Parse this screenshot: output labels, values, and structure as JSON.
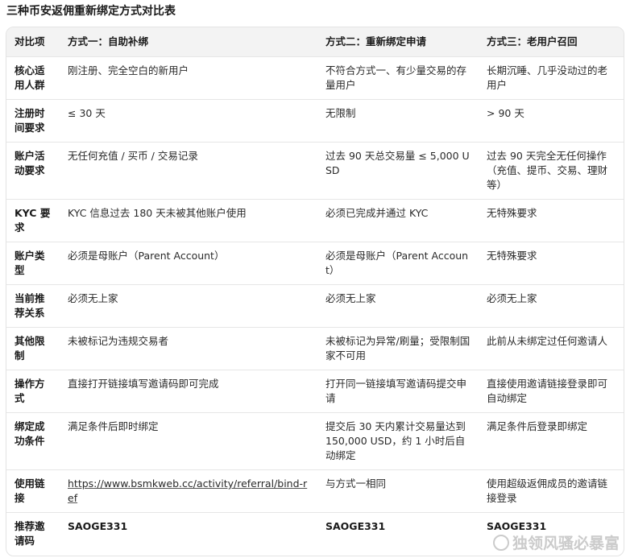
{
  "title": "三种币安返佣重新绑定方式对比表",
  "table": {
    "headers": [
      "对比项",
      "方式一：自助补绑",
      "方式二：重新绑定申请",
      "方式三：老用户召回"
    ],
    "rows": [
      [
        "核心适用人群",
        "刚注册、完全空白的新用户",
        "不符合方式一、有少量交易的存量用户",
        "长期沉睡、几乎没动过的老用户"
      ],
      [
        "注册时间要求",
        "≤ 30 天",
        "无限制",
        "> 90 天"
      ],
      [
        "账户活动要求",
        "无任何充值 / 买币 / 交易记录",
        "过去 90 天总交易量 ≤ 5,000 USD",
        "过去 90 天完全无任何操作（充值、提币、交易、理财等）"
      ],
      [
        "KYC 要求",
        "KYC 信息过去 180 天未被其他账户使用",
        "必须已完成并通过 KYC",
        "无特殊要求"
      ],
      [
        "账户类型",
        "必须是母账户（Parent Account）",
        "必须是母账户（Parent Account）",
        "无特殊要求"
      ],
      [
        "当前推荐关系",
        "必须无上家",
        "必须无上家",
        "必须无上家"
      ],
      [
        "其他限制",
        "未被标记为违规交易者",
        "未被标记为异常/刷量；受限制国家不可用",
        "此前从未绑定过任何邀请人"
      ],
      [
        "操作方式",
        "直接打开链接填写邀请码即可完成",
        "打开同一链接填写邀请码提交申请",
        "直接使用邀请链接登录即可自动绑定"
      ],
      [
        "绑定成功条件",
        "满足条件后即时绑定",
        "提交后 30 天内累计交易量达到 150,000 USD，约 1 小时后自动绑定",
        "满足条件后登录即绑定"
      ],
      [
        "使用链接",
        "https://www.bsmkweb.cc/activity/referral/bind-ref",
        "与方式一相同",
        "使用超级返佣成员的邀请链接登录"
      ],
      [
        "推荐邀请码",
        "SAOGE331",
        "SAOGE331",
        "SAOGE331"
      ]
    ]
  },
  "watermark": {
    "text": "独领风骚必暴富",
    "icon": "weibo-style-icon"
  }
}
